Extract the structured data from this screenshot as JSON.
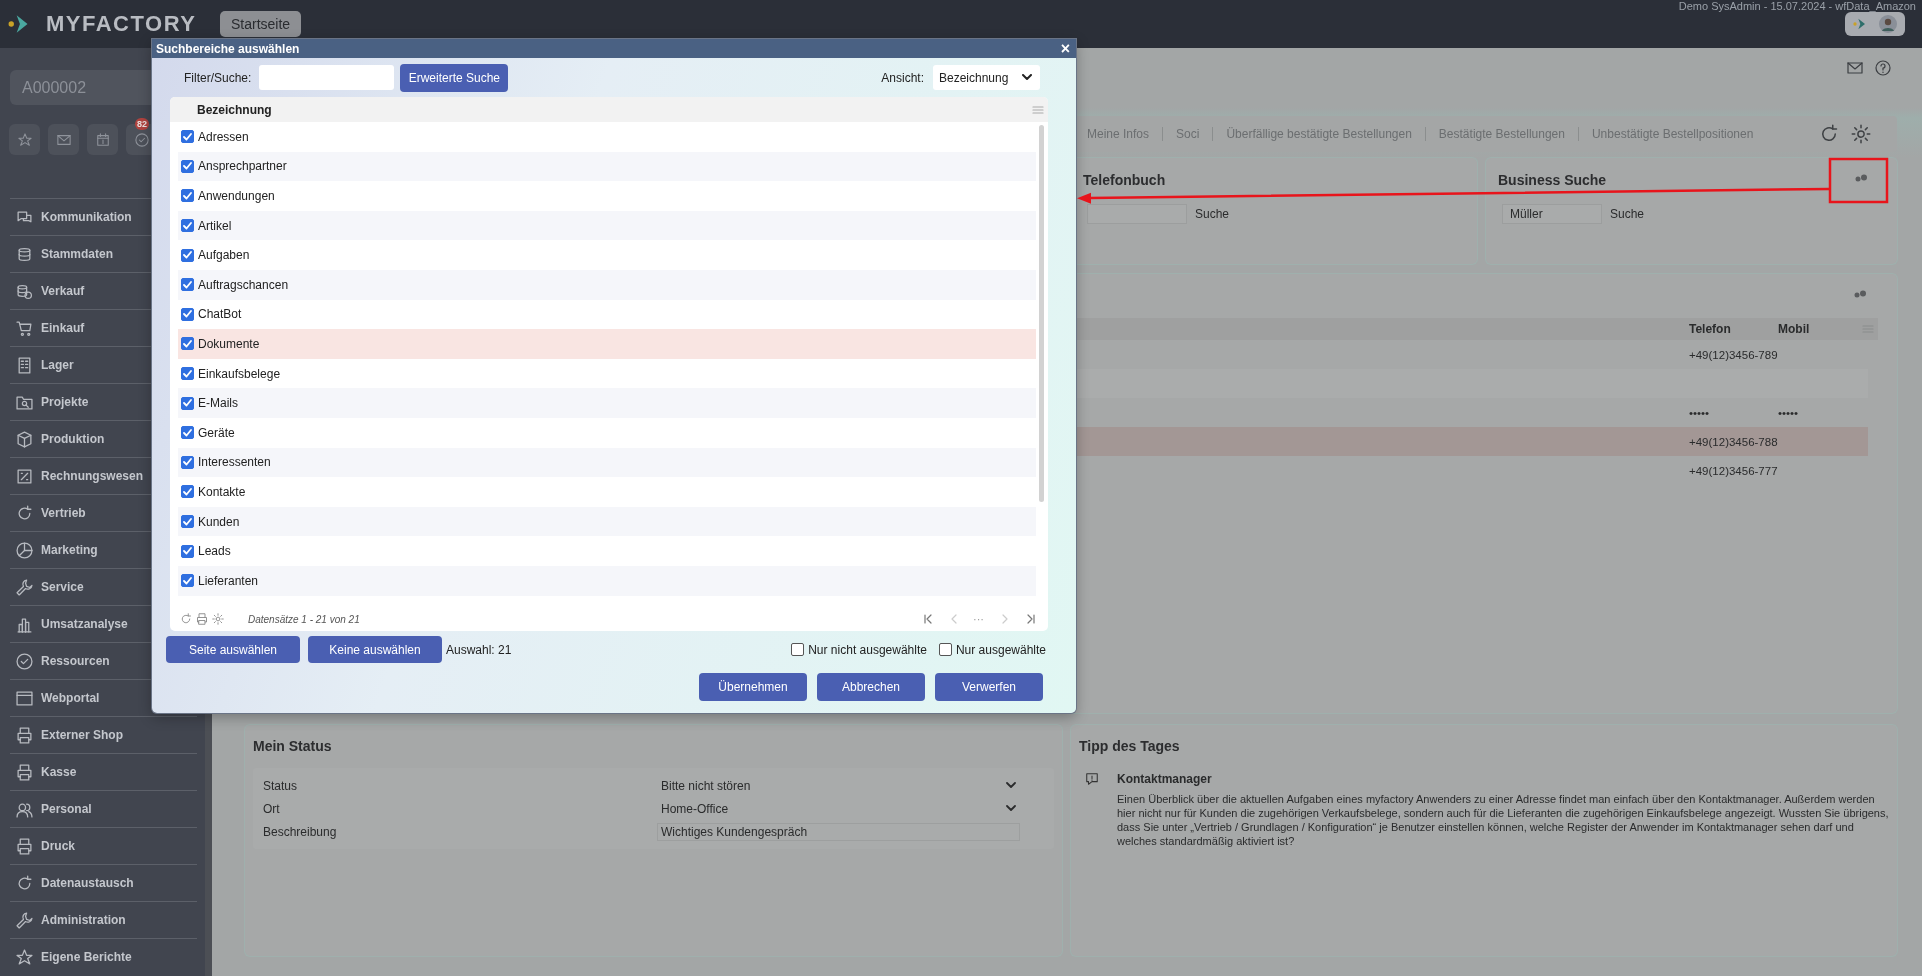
{
  "app": {
    "logo": "MYFACTORY",
    "tab": "Startseite",
    "session": "Demo SysAdmin - 15.07.2024 - wfData_Amazon"
  },
  "sidebar": {
    "search_value": "A000002",
    "badge": "82",
    "items": [
      {
        "label": "Kommunikation"
      },
      {
        "label": "Stammdaten"
      },
      {
        "label": "Verkauf"
      },
      {
        "label": "Einkauf"
      },
      {
        "label": "Lager"
      },
      {
        "label": "Projekte"
      },
      {
        "label": "Produktion"
      },
      {
        "label": "Rechnungswesen"
      },
      {
        "label": "Vertrieb"
      },
      {
        "label": "Marketing"
      },
      {
        "label": "Service"
      },
      {
        "label": "Umsatzanalyse"
      },
      {
        "label": "Ressourcen"
      },
      {
        "label": "Webportal"
      },
      {
        "label": "Externer Shop"
      },
      {
        "label": "Kasse"
      },
      {
        "label": "Personal"
      },
      {
        "label": "Druck"
      },
      {
        "label": "Datenaustausch"
      },
      {
        "label": "Administration"
      },
      {
        "label": "Eigene Berichte"
      }
    ]
  },
  "tabs": [
    {
      "label": "Meine Infos"
    },
    {
      "label": "Soci"
    },
    {
      "label": "Überfällige bestätigte Bestellungen"
    },
    {
      "label": "Bestätigte Bestellungen"
    },
    {
      "label": "Unbestätigte Bestellpositionen"
    }
  ],
  "phonebook": {
    "title": "Telefonbuch",
    "button": "Suche"
  },
  "business_search": {
    "title": "Business Suche",
    "value": "Müller",
    "button": "Suche"
  },
  "contacts": {
    "columns": [
      "Telefon",
      "Mobil"
    ],
    "rows": [
      {
        "phone": "+49(12)3456-789",
        "selected": false
      },
      {
        "selected": false
      },
      {
        "phone": "•••••",
        "mobile": "•••••",
        "selected": false
      },
      {
        "phone": "+49(12)3456-788",
        "selected": true
      },
      {
        "phone": "+49(12)3456-777",
        "selected": false
      }
    ]
  },
  "my_status": {
    "title": "Mein Status",
    "fields": [
      {
        "label": "Status",
        "value": "Bitte nicht stören",
        "kind": "select"
      },
      {
        "label": "Ort",
        "value": "Home-Office",
        "kind": "select"
      },
      {
        "label": "Beschreibung",
        "value": "Wichtiges Kundengespräch",
        "kind": "text"
      }
    ]
  },
  "tip": {
    "title": "Tipp des Tages",
    "heading": "Kontaktmanager",
    "text": "Einen Überblick über die aktuellen Aufgaben eines myfactory Anwenders zu einer Adresse findet man einfach über den Kontaktmanager. Außerdem werden hier nicht nur für Kunden die zugehörigen Verkaufsbelege, sondern auch für die Lieferanten die zugehörigen Einkaufsbelege angezeigt. Wussten Sie übrigens, dass Sie unter „Vertrieb / Grundlagen / Konfiguration“ je Benutzer einstellen können, welche Register der Anwender im Kontaktmanager sehen darf und welches standardmäßig aktiviert ist?"
  },
  "dialog": {
    "title": "Suchbereiche auswählen",
    "close": "×",
    "filter_label": "Filter/Suche:",
    "advanced_button": "Erweiterte Suche",
    "view_label": "Ansicht:",
    "view_value": "Bezeichnung",
    "column": "Bezeichnung",
    "items": [
      {
        "label": "Adressen",
        "checked": true,
        "selected": false
      },
      {
        "label": "Ansprechpartner",
        "checked": true,
        "selected": false
      },
      {
        "label": "Anwendungen",
        "checked": true,
        "selected": false
      },
      {
        "label": "Artikel",
        "checked": true,
        "selected": false
      },
      {
        "label": "Aufgaben",
        "checked": true,
        "selected": false
      },
      {
        "label": "Auftragschancen",
        "checked": true,
        "selected": false
      },
      {
        "label": "ChatBot",
        "checked": true,
        "selected": false
      },
      {
        "label": "Dokumente",
        "checked": true,
        "selected": true
      },
      {
        "label": "Einkaufsbelege",
        "checked": true,
        "selected": false
      },
      {
        "label": "E-Mails",
        "checked": true,
        "selected": false
      },
      {
        "label": "Geräte",
        "checked": true,
        "selected": false
      },
      {
        "label": "Interessenten",
        "checked": true,
        "selected": false
      },
      {
        "label": "Kontakte",
        "checked": true,
        "selected": false
      },
      {
        "label": "Kunden",
        "checked": true,
        "selected": false
      },
      {
        "label": "Leads",
        "checked": true,
        "selected": false
      },
      {
        "label": "Lieferanten",
        "checked": true,
        "selected": false
      }
    ],
    "records": "Datensätze 1 - 21 von 21",
    "pager_ellipsis": "···",
    "select_page": "Seite auswählen",
    "select_none": "Keine auswählen",
    "selection": "Auswahl: 21",
    "filters": [
      {
        "label": "Nur nicht ausgewählte",
        "checked": false
      },
      {
        "label": "Nur ausgewählte",
        "checked": false
      }
    ],
    "actions": [
      "Übernehmen",
      "Abbrechen",
      "Verwerfen"
    ]
  }
}
